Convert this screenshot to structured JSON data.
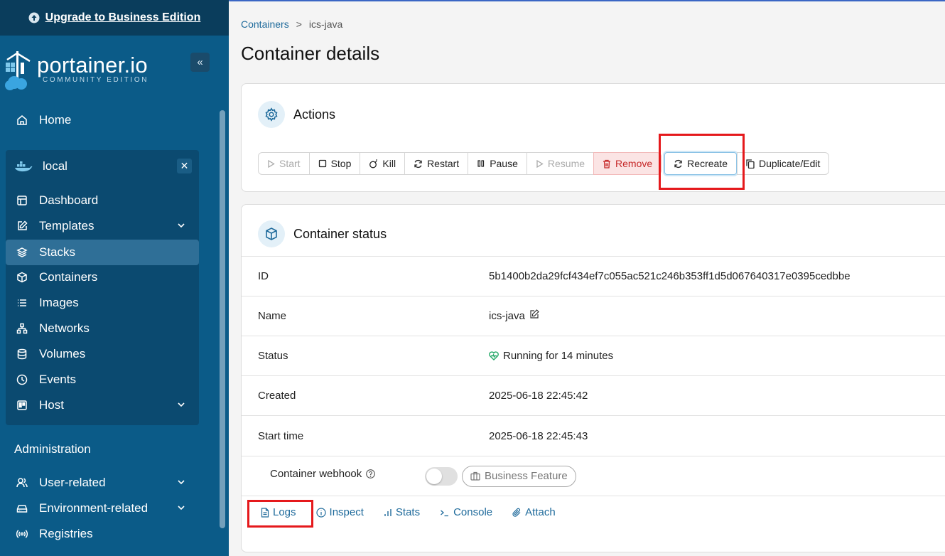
{
  "upgrade": {
    "label": "Upgrade to Business Edition"
  },
  "logo": {
    "name": "portainer.io",
    "edition": "COMMUNITY EDITION"
  },
  "sidebar": {
    "home": "Home",
    "environment": {
      "name": "local"
    },
    "env_items": [
      {
        "label": "Dashboard",
        "icon": "dashboard-icon"
      },
      {
        "label": "Templates",
        "icon": "edit-icon",
        "expandable": true
      },
      {
        "label": "Stacks",
        "icon": "layers-icon",
        "active": true
      },
      {
        "label": "Containers",
        "icon": "box-icon"
      },
      {
        "label": "Images",
        "icon": "list-icon"
      },
      {
        "label": "Networks",
        "icon": "network-icon"
      },
      {
        "label": "Volumes",
        "icon": "database-icon"
      },
      {
        "label": "Events",
        "icon": "clock-icon"
      },
      {
        "label": "Host",
        "icon": "host-icon",
        "expandable": true
      }
    ],
    "admin_title": "Administration",
    "admin_items": [
      {
        "label": "User-related",
        "expandable": true
      },
      {
        "label": "Environment-related",
        "expandable": true
      },
      {
        "label": "Registries"
      }
    ]
  },
  "breadcrumb": {
    "parent": "Containers",
    "separator": ">",
    "current": "ics-java"
  },
  "page_title": "Container details",
  "actions": {
    "title": "Actions",
    "buttons": {
      "start": "Start",
      "stop": "Stop",
      "kill": "Kill",
      "restart": "Restart",
      "pause": "Pause",
      "resume": "Resume",
      "remove": "Remove",
      "recreate": "Recreate",
      "duplicate": "Duplicate/Edit"
    }
  },
  "status": {
    "title": "Container status",
    "id_label": "ID",
    "id_value": "5b1400b2da29fcf434ef7c055ac521c246b353ff1d5d067640317e0395cedbbe",
    "name_label": "Name",
    "name_value": "ics-java",
    "status_label": "Status",
    "status_value": "Running for 14 minutes",
    "created_label": "Created",
    "created_value": "2025-06-18 22:45:42",
    "start_label": "Start time",
    "start_value": "2025-06-18 22:45:43",
    "webhook_label": "Container webhook",
    "business_badge": "Business Feature"
  },
  "tabs": {
    "logs": "Logs",
    "inspect": "Inspect",
    "stats": "Stats",
    "console": "Console",
    "attach": "Attach"
  },
  "colors": {
    "sidebar_bg": "#0b5b88",
    "accent": "#1e6a9b",
    "danger": "#c62828",
    "highlight": "#e5191c",
    "running": "#23a867"
  }
}
